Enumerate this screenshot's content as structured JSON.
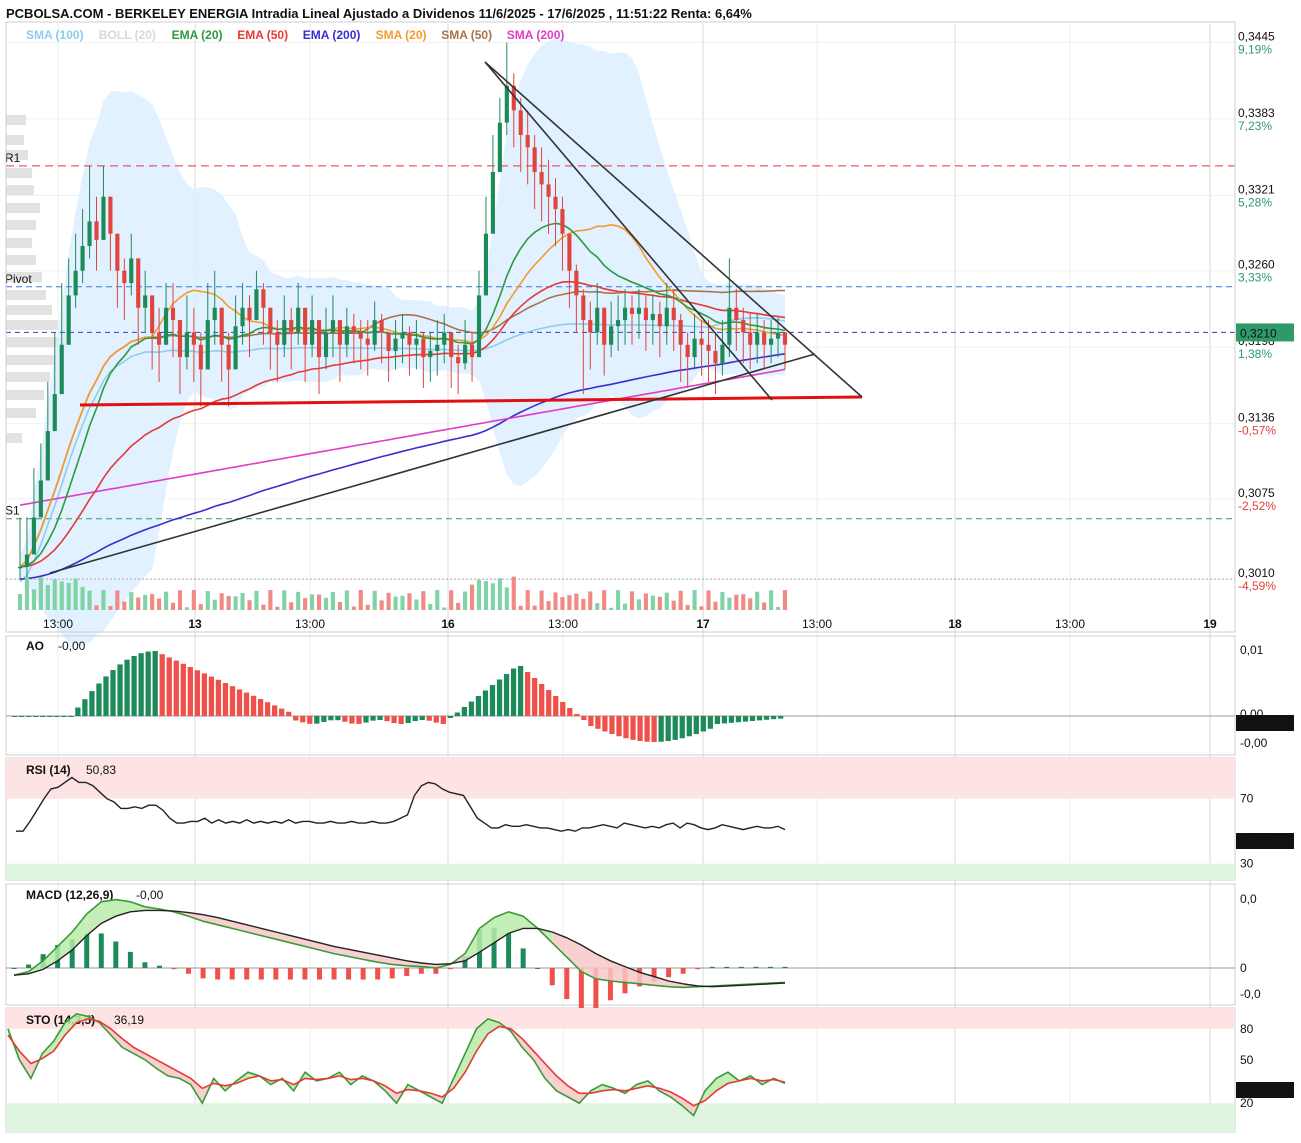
{
  "title": "PCBOLSA.COM - BERKELEY ENERGIA Intradia Lineal Ajustado a Dividenos 11/6/2025 - 17/6/2025 , 11:51:22 Renta: 6,64%",
  "legend": [
    {
      "label": "SMA (100)",
      "color": "#8ecdf0"
    },
    {
      "label": "BOLL (20)",
      "color": "#d8d8d8"
    },
    {
      "label": "EMA (20)",
      "color": "#2e9a3e"
    },
    {
      "label": "EMA (50)",
      "color": "#e53935"
    },
    {
      "label": "EMA (200)",
      "color": "#3b2ecf"
    },
    {
      "label": "SMA (20)",
      "color": "#f39c2b"
    },
    {
      "label": "SMA (50)",
      "color": "#a8744a"
    },
    {
      "label": "SMA (200)",
      "color": "#e23bc7"
    }
  ],
  "levels": {
    "r1": {
      "label": "R1",
      "value": 0.3345,
      "color": "#e53935"
    },
    "pivot": {
      "label": "Pivot",
      "value": 0.3247,
      "color": "#3a78d8"
    },
    "s1": {
      "label": "S1",
      "value": 0.3059,
      "color": "#2e9a6a"
    },
    "last": {
      "label": "0,3210",
      "value": 0.321,
      "color": "#2e9a6a"
    },
    "base": {
      "value": 0.301
    }
  },
  "price_axis": [
    {
      "price": "0,3445",
      "pct": "9,19%",
      "sign": "pos",
      "value": 0.3445
    },
    {
      "price": "0,3383",
      "pct": "7,23%",
      "sign": "pos",
      "value": 0.3383
    },
    {
      "price": "0,3321",
      "pct": "5,28%",
      "sign": "pos",
      "value": 0.3321
    },
    {
      "price": "0,3260",
      "pct": "3,33%",
      "sign": "pos",
      "value": 0.326
    },
    {
      "price": "0,3198",
      "pct": "1,38%",
      "sign": "pos",
      "value": 0.3198
    },
    {
      "price": "0,3136",
      "pct": "-0,57%",
      "sign": "neg",
      "value": 0.3136
    },
    {
      "price": "0,3075",
      "pct": "-2,52%",
      "sign": "neg",
      "value": 0.3075
    },
    {
      "price": "0,3010",
      "pct": "-4,59%",
      "sign": "neg",
      "value": 0.301
    }
  ],
  "time_axis": [
    {
      "label": "13:00",
      "major": false
    },
    {
      "label": "13",
      "major": true
    },
    {
      "label": "13:00",
      "major": false
    },
    {
      "label": "16",
      "major": true
    },
    {
      "label": "13:00",
      "major": false
    },
    {
      "label": "17",
      "major": true
    },
    {
      "label": "13:00",
      "major": false
    },
    {
      "label": "18",
      "major": true
    },
    {
      "label": "13:00",
      "major": false
    },
    {
      "label": "19",
      "major": true
    }
  ],
  "chart_data": [
    {
      "type": "candlestick",
      "title": "PCBOLSA.COM - BERKELEY ENERGIA Intradia Lineal Ajustado a Dividenos 11/6/2025 - 17/6/2025 , 11:51:22 Renta: 6,64%",
      "ylim": [
        0.2985,
        0.346
      ],
      "close": [
        0.302,
        0.303,
        0.306,
        0.309,
        0.313,
        0.316,
        0.32,
        0.324,
        0.326,
        0.328,
        0.33,
        0.3285,
        0.332,
        0.329,
        0.326,
        0.325,
        0.327,
        0.323,
        0.324,
        0.321,
        0.32,
        0.323,
        0.322,
        0.319,
        0.321,
        0.32,
        0.318,
        0.322,
        0.323,
        0.32,
        0.318,
        0.3215,
        0.323,
        0.322,
        0.3245,
        0.323,
        0.321,
        0.32,
        0.322,
        0.321,
        0.323,
        0.32,
        0.322,
        0.319,
        0.321,
        0.322,
        0.32,
        0.3215,
        0.321,
        0.3205,
        0.32,
        0.322,
        0.321,
        0.3195,
        0.3205,
        0.321,
        0.32,
        0.3205,
        0.319,
        0.3195,
        0.32,
        0.321,
        0.319,
        0.3185,
        0.32,
        0.319,
        0.324,
        0.329,
        0.334,
        0.338,
        0.341,
        0.339,
        0.337,
        0.336,
        0.334,
        0.333,
        0.332,
        0.331,
        0.329,
        0.326,
        0.324,
        0.322,
        0.321,
        0.323,
        0.32,
        0.3215,
        0.322,
        0.323,
        0.3225,
        0.323,
        0.322,
        0.3225,
        0.3215,
        0.323,
        0.322,
        0.32,
        0.319,
        0.3205,
        0.32,
        0.3195,
        0.3185,
        0.32,
        0.323,
        0.322,
        0.321,
        0.32,
        0.321,
        0.32,
        0.3205,
        0.321,
        0.32
      ],
      "high": [
        0.306,
        0.306,
        0.31,
        0.312,
        0.317,
        0.321,
        0.325,
        0.327,
        0.329,
        0.331,
        0.3345,
        0.332,
        0.3345,
        0.332,
        0.3285,
        0.327,
        0.329,
        0.326,
        0.326,
        0.324,
        0.323,
        0.325,
        0.325,
        0.322,
        0.324,
        0.323,
        0.321,
        0.325,
        0.326,
        0.323,
        0.321,
        0.324,
        0.325,
        0.324,
        0.326,
        0.325,
        0.323,
        0.322,
        0.324,
        0.323,
        0.325,
        0.322,
        0.324,
        0.321,
        0.323,
        0.324,
        0.322,
        0.323,
        0.3225,
        0.322,
        0.322,
        0.3235,
        0.3225,
        0.321,
        0.322,
        0.3225,
        0.3215,
        0.322,
        0.321,
        0.321,
        0.322,
        0.3225,
        0.321,
        0.32,
        0.322,
        0.321,
        0.326,
        0.332,
        0.337,
        0.34,
        0.3445,
        0.342,
        0.34,
        0.339,
        0.337,
        0.336,
        0.335,
        0.3335,
        0.332,
        0.3285,
        0.3265,
        0.3245,
        0.3235,
        0.325,
        0.323,
        0.3235,
        0.324,
        0.3245,
        0.324,
        0.3245,
        0.324,
        0.324,
        0.3235,
        0.325,
        0.3245,
        0.3225,
        0.321,
        0.3225,
        0.322,
        0.322,
        0.321,
        0.322,
        0.327,
        0.3245,
        0.323,
        0.3225,
        0.3225,
        0.322,
        0.322,
        0.3222,
        0.321
      ],
      "low": [
        0.301,
        0.301,
        0.303,
        0.306,
        0.31,
        0.313,
        0.317,
        0.321,
        0.323,
        0.325,
        0.327,
        0.326,
        0.329,
        0.326,
        0.323,
        0.322,
        0.324,
        0.32,
        0.321,
        0.318,
        0.317,
        0.32,
        0.319,
        0.316,
        0.318,
        0.317,
        0.315,
        0.319,
        0.32,
        0.317,
        0.315,
        0.319,
        0.32,
        0.319,
        0.322,
        0.32,
        0.318,
        0.317,
        0.319,
        0.318,
        0.32,
        0.317,
        0.319,
        0.316,
        0.318,
        0.319,
        0.317,
        0.319,
        0.3185,
        0.318,
        0.3175,
        0.3195,
        0.3185,
        0.317,
        0.318,
        0.3185,
        0.3175,
        0.318,
        0.3165,
        0.317,
        0.3175,
        0.3185,
        0.3165,
        0.316,
        0.318,
        0.317,
        0.32,
        0.325,
        0.33,
        0.334,
        0.337,
        0.336,
        0.334,
        0.333,
        0.331,
        0.33,
        0.329,
        0.328,
        0.326,
        0.323,
        0.321,
        0.316,
        0.318,
        0.32,
        0.3175,
        0.319,
        0.3195,
        0.32,
        0.32,
        0.3205,
        0.3195,
        0.32,
        0.319,
        0.32,
        0.3195,
        0.317,
        0.3165,
        0.318,
        0.3175,
        0.317,
        0.316,
        0.3175,
        0.319,
        0.3195,
        0.3185,
        0.318,
        0.3185,
        0.318,
        0.3185,
        0.319,
        0.318
      ]
    },
    {
      "type": "line",
      "title": "AO",
      "series": [
        {
          "name": "AO",
          "value_label": "-0,00"
        }
      ],
      "axis_labels": [
        "0,01",
        "0,00",
        "-0,00"
      ],
      "last_value": "-0,001"
    },
    {
      "type": "line",
      "title": "RSI (14)",
      "series": [
        {
          "name": "RSI (14)",
          "value_label": "50,83"
        }
      ],
      "axis_labels": [
        "70",
        "30"
      ],
      "last_value": "50,834",
      "values": [
        50,
        50,
        56,
        63,
        70,
        76,
        77,
        80,
        83,
        80,
        80,
        78,
        74,
        70,
        68,
        64,
        64,
        65,
        64,
        66,
        66,
        63,
        58,
        55,
        55,
        56,
        56,
        58,
        55,
        57,
        55,
        56,
        55,
        57,
        55,
        56,
        55,
        56,
        55,
        57,
        55,
        56,
        56,
        55,
        55,
        56,
        55,
        55,
        56,
        55,
        55,
        56,
        55,
        55,
        56,
        58,
        60,
        72,
        78,
        80,
        79,
        76,
        74,
        73,
        72,
        65,
        58,
        55,
        52,
        52,
        54,
        53,
        53,
        54,
        53,
        52,
        52,
        51,
        50,
        51,
        50,
        52,
        52,
        53,
        54,
        53,
        52,
        55,
        54,
        53,
        52,
        53,
        52,
        54,
        55,
        52,
        55,
        54,
        52,
        51,
        52,
        54,
        53,
        52,
        51,
        52,
        53,
        52,
        52,
        53,
        51
      ]
    },
    {
      "type": "line",
      "title": "MACD (12,26,9)",
      "series": [
        {
          "name": "MACD (12,26,9)",
          "value_label": "-0,00"
        }
      ],
      "axis_labels": [
        "0,0",
        "0",
        "-0,0"
      ],
      "values": [
        -0.1,
        -0.05,
        0.1,
        0.3,
        0.5,
        0.75,
        0.92,
        0.95,
        0.92,
        0.85,
        0.82,
        0.78,
        0.72,
        0.65,
        0.6,
        0.55,
        0.5,
        0.45,
        0.4,
        0.35,
        0.3,
        0.25,
        0.2,
        0.16,
        0.12,
        0.08,
        0.05,
        0.03,
        0.02,
        0.0,
        0.05,
        0.2,
        0.55,
        0.7,
        0.78,
        0.72,
        0.55,
        0.35,
        0.15,
        -0.05,
        -0.15,
        -0.18,
        -0.2,
        -0.22,
        -0.24,
        -0.26,
        -0.27,
        -0.26,
        -0.25,
        -0.24,
        -0.23,
        -0.22,
        -0.21,
        -0.2
      ],
      "signal": [
        -0.1,
        -0.08,
        -0.02,
        0.1,
        0.25,
        0.45,
        0.62,
        0.72,
        0.78,
        0.8,
        0.8,
        0.79,
        0.77,
        0.74,
        0.7,
        0.65,
        0.6,
        0.55,
        0.5,
        0.45,
        0.4,
        0.35,
        0.3,
        0.26,
        0.22,
        0.18,
        0.14,
        0.1,
        0.07,
        0.05,
        0.06,
        0.1,
        0.22,
        0.35,
        0.48,
        0.55,
        0.55,
        0.5,
        0.42,
        0.32,
        0.2,
        0.1,
        0.02,
        -0.06,
        -0.12,
        -0.18,
        -0.22,
        -0.25,
        -0.26,
        -0.25,
        -0.24,
        -0.23,
        -0.22,
        -0.21
      ]
    },
    {
      "type": "line",
      "title": "STO (14,3,5)",
      "series": [
        {
          "name": "STO (14,3,5)",
          "value_label": "36,19"
        }
      ],
      "axis_labels": [
        "80",
        "50",
        "20"
      ],
      "last_value": "36,193",
      "k": [
        80,
        55,
        40,
        60,
        70,
        85,
        92,
        90,
        85,
        75,
        65,
        60,
        55,
        48,
        42,
        40,
        35,
        20,
        40,
        30,
        38,
        45,
        42,
        35,
        40,
        30,
        45,
        38,
        40,
        45,
        35,
        42,
        38,
        30,
        20,
        35,
        30,
        25,
        20,
        40,
        60,
        80,
        88,
        85,
        78,
        65,
        55,
        40,
        30,
        25,
        20,
        30,
        35,
        32,
        28,
        35,
        38,
        30,
        25,
        18,
        10,
        30,
        40,
        45,
        38,
        42,
        35,
        40,
        36
      ],
      "d": [
        75,
        62,
        52,
        56,
        62,
        75,
        85,
        88,
        86,
        80,
        72,
        65,
        60,
        55,
        50,
        45,
        40,
        32,
        36,
        34,
        36,
        40,
        42,
        38,
        39,
        35,
        40,
        39,
        40,
        42,
        39,
        40,
        38,
        34,
        28,
        31,
        30,
        28,
        25,
        32,
        45,
        62,
        76,
        82,
        80,
        72,
        62,
        52,
        42,
        34,
        28,
        28,
        30,
        31,
        30,
        32,
        34,
        32,
        29,
        24,
        18,
        22,
        30,
        36,
        38,
        40,
        38,
        39,
        37
      ]
    }
  ]
}
